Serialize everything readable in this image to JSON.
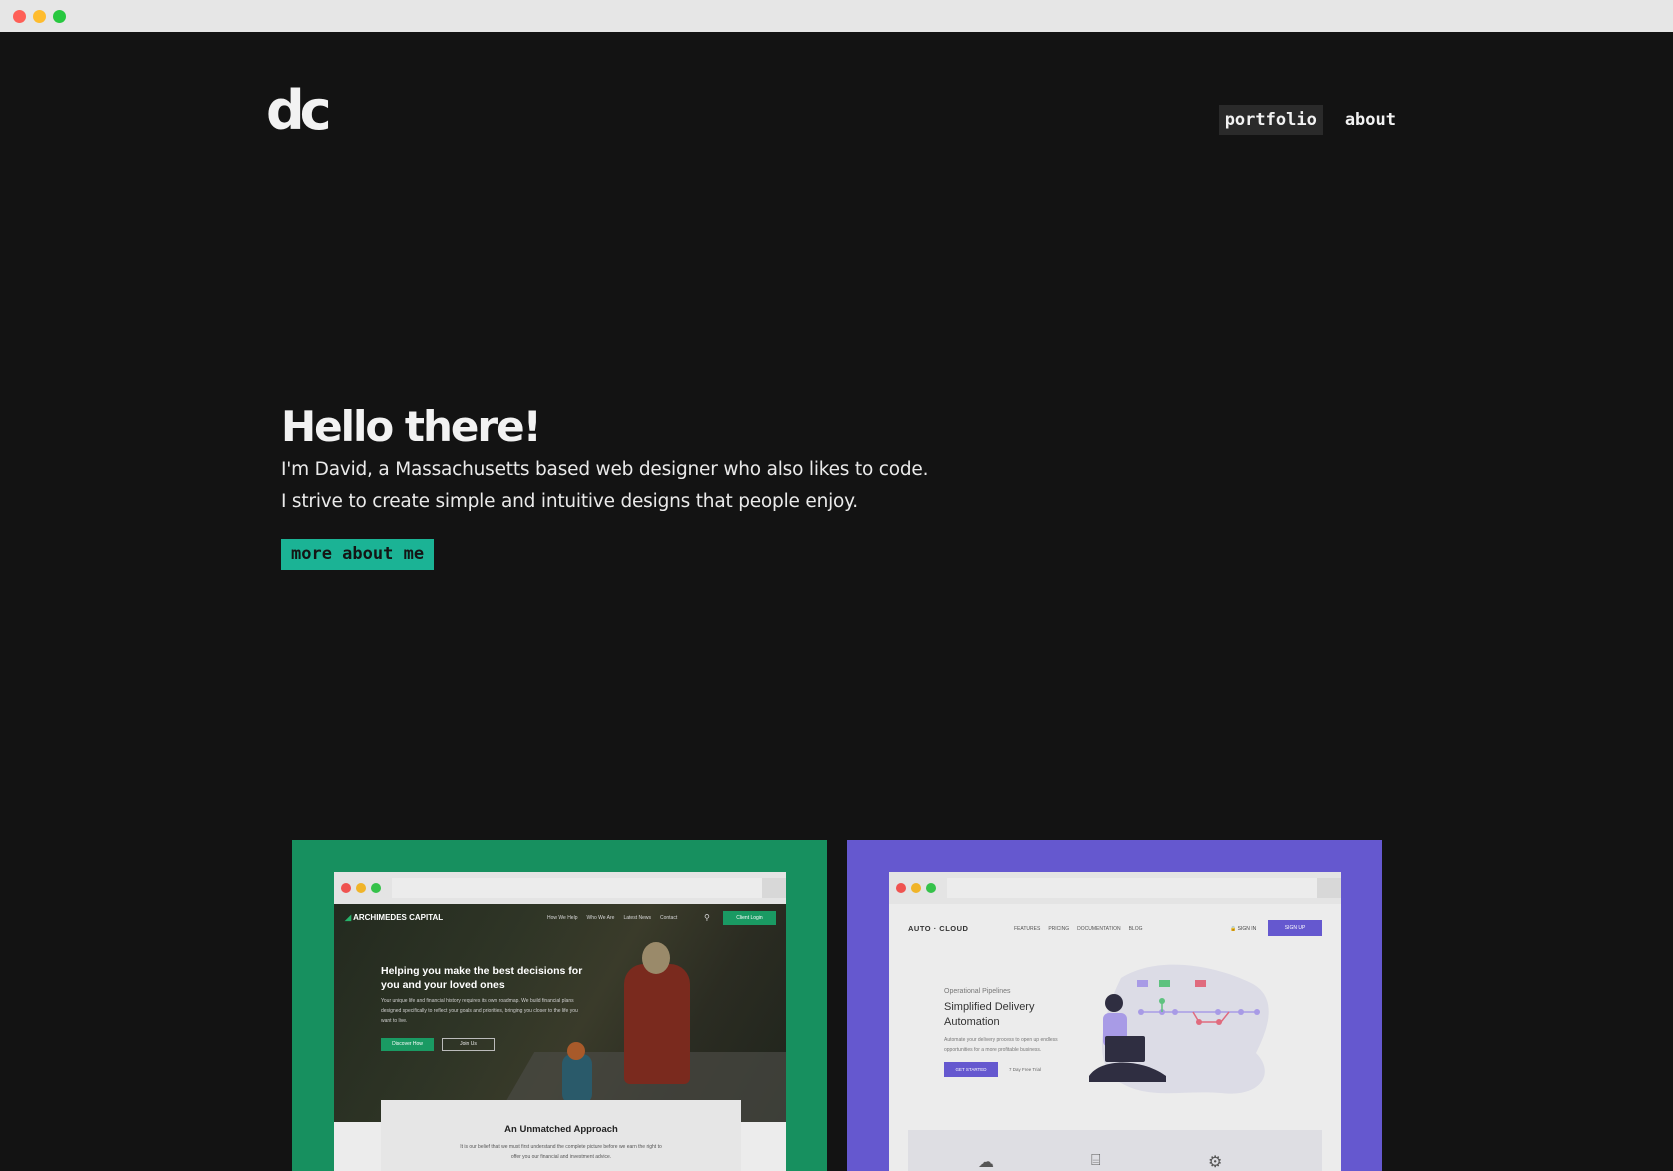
{
  "header": {
    "logo": "dc",
    "nav": [
      {
        "label": "portfolio",
        "active": true
      },
      {
        "label": "about",
        "active": false
      }
    ]
  },
  "hero": {
    "title": "Hello there!",
    "line1": "I'm David, a Massachusetts based web designer who also likes to code.",
    "line2": "I strive to create simple and intuitive designs that people enjoy.",
    "button": "more about me"
  },
  "colors": {
    "background": "#131313",
    "accent": "#1bb395",
    "card_green": "#17905f",
    "card_purple": "#6558cf"
  },
  "portfolio": [
    {
      "site": "archimedes",
      "logo": "ARCHIMEDES CAPITAL",
      "nav": [
        "How We Help",
        "Who We Are",
        "Latest News",
        "Contact"
      ],
      "login": "Client Login",
      "headline": "Helping you make the best decisions for you and your loved ones",
      "body": "Your unique life and financial history requires its own roadmap. We build financial plans designed specifically to reflect your goals and priorities, bringing you closer to the life you want to live.",
      "primary_button": "Discover How",
      "secondary_button": "Join Us",
      "section_title": "An Unmatched Approach",
      "section_text": "It is our belief that we must first understand the complete picture before we earn the right to offer you our financial and investment advice."
    },
    {
      "site": "autocloud",
      "logo": "AUTO · CLOUD",
      "nav": [
        "FEATURES",
        "PRICING",
        "DOCUMENTATION",
        "BLOG"
      ],
      "signin": "SIGN IN",
      "signup": "SIGN UP",
      "eyebrow": "Operational Pipelines",
      "headline": "Simplified Delivery Automation",
      "body": "Automate your delivery process to open up endless opportunities for a more profitable business.",
      "primary_button": "GET STARTED",
      "trial": "7 Day Free Trial"
    }
  ]
}
